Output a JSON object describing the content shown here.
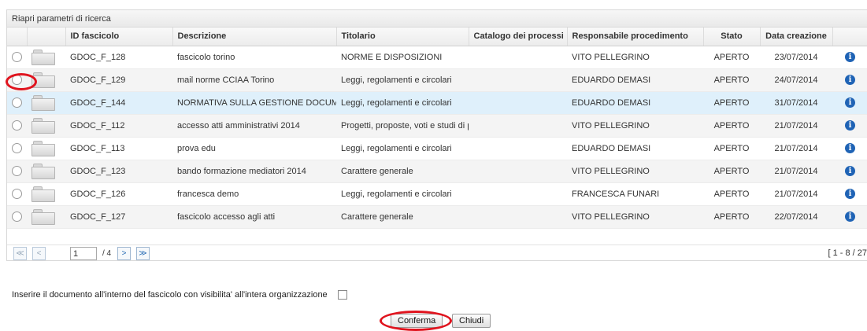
{
  "panel": {
    "title": "Riapri parametri di ricerca"
  },
  "columns": [
    "",
    "",
    "ID fascicolo",
    "Descrizione",
    "Titolario",
    "Catalogo dei processi",
    "Responsabile procedimento",
    "Stato",
    "Data creazione",
    ""
  ],
  "rows": [
    {
      "id": "GDOC_F_128",
      "descrizione": "fascicolo torino",
      "titolario": "NORME E DISPOSIZIONI",
      "catalogo": "",
      "responsabile": "VITO PELLEGRINO",
      "stato": "APERTO",
      "data": "23/07/2014"
    },
    {
      "id": "GDOC_F_129",
      "descrizione": "mail norme CCIAA Torino",
      "titolario": "Leggi, regolamenti e circolari",
      "catalogo": "",
      "responsabile": "EDUARDO DEMASI",
      "stato": "APERTO",
      "data": "24/07/2014"
    },
    {
      "id": "GDOC_F_144",
      "descrizione": "NORMATIVA SULLA GESTIONE DOCUMI",
      "titolario": "Leggi, regolamenti e circolari",
      "catalogo": "",
      "responsabile": "EDUARDO DEMASI",
      "stato": "APERTO",
      "data": "31/07/2014"
    },
    {
      "id": "GDOC_F_112",
      "descrizione": "accesso atti amministrativi 2014",
      "titolario": "Progetti, proposte, voti e studi di p",
      "catalogo": "",
      "responsabile": "VITO PELLEGRINO",
      "stato": "APERTO",
      "data": "21/07/2014"
    },
    {
      "id": "GDOC_F_113",
      "descrizione": "prova edu",
      "titolario": "Leggi, regolamenti e circolari",
      "catalogo": "",
      "responsabile": "EDUARDO DEMASI",
      "stato": "APERTO",
      "data": "21/07/2014"
    },
    {
      "id": "GDOC_F_123",
      "descrizione": "bando formazione mediatori 2014",
      "titolario": "Carattere generale",
      "catalogo": "",
      "responsabile": "VITO PELLEGRINO",
      "stato": "APERTO",
      "data": "21/07/2014"
    },
    {
      "id": "GDOC_F_126",
      "descrizione": "francesca demo",
      "titolario": "Leggi, regolamenti e circolari",
      "catalogo": "",
      "responsabile": "FRANCESCA FUNARI",
      "stato": "APERTO",
      "data": "21/07/2014"
    },
    {
      "id": "GDOC_F_127",
      "descrizione": "fascicolo accesso agli atti",
      "titolario": "Carattere generale",
      "catalogo": "",
      "responsabile": "VITO PELLEGRINO",
      "stato": "APERTO",
      "data": "22/07/2014"
    }
  ],
  "pager": {
    "first": "≪",
    "prev": "<",
    "next": ">",
    "last": "≫",
    "page_value": "1",
    "page_total": "/ 4",
    "range": "[ 1 - 8 / 27"
  },
  "visibility_label": "Inserire il documento all'interno del fascicolo con visibilita' all'intera organizzazione",
  "buttons": {
    "confirm": "Conferma",
    "close": "Chiudi"
  },
  "colors": {
    "selected_row": "#dff0fb",
    "alt_row": "#f4f4f4",
    "info_icon": "#1f63b5",
    "annotation": "#e0141e"
  },
  "icons": {
    "row_folder": "folder-icon",
    "row_info": "info-icon"
  }
}
